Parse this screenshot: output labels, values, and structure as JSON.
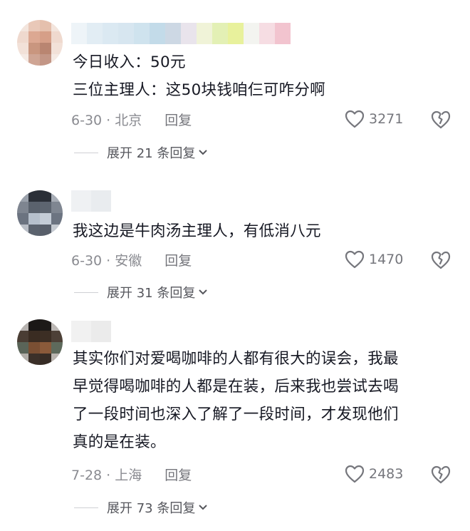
{
  "comments": [
    {
      "lines": [
        "今日收入：50元",
        "三位主理人：这50块钱咱仨可咋分啊"
      ],
      "date_location": "6-30 · 北京",
      "reply_label": "回复",
      "likes": "3271",
      "expand_label": "展开 21 条回复"
    },
    {
      "lines": [
        "我这边是牛肉汤主理人，有低消八元"
      ],
      "date_location": "6-30 · 安徽",
      "reply_label": "回复",
      "likes": "1470",
      "expand_label": "展开 31 条回复"
    },
    {
      "lines": [
        "其实你们对爱喝咖啡的人都有很大的误会，我最",
        "早觉得喝咖啡的人都是在装，后来我也尝试去喝",
        "了一段时间也深入了解了一段时间，才发现他们",
        "真的是在装。"
      ],
      "date_location": "7-28 · 上海",
      "reply_label": "回复",
      "likes": "2483",
      "expand_label": "展开 73 条回复"
    }
  ],
  "icons": {
    "like": "heart-outline-icon",
    "dislike": "broken-heart-icon",
    "expand": "chevron-down-icon"
  },
  "colors": {
    "text": "#161823",
    "meta": "#8a8b91",
    "icon": "#75767c"
  }
}
